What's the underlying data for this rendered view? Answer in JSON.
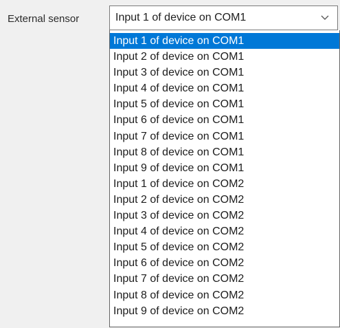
{
  "field": {
    "label": "External sensor",
    "selected_value": "Input 1 of device on COM1",
    "dropdown_icon": "chevron-down-icon"
  },
  "colors": {
    "highlight": "#0078d7",
    "highlight_text": "#ffffff",
    "text": "#1c1c1c"
  },
  "options": [
    {
      "label": "Input 1 of device on COM1",
      "selected": true
    },
    {
      "label": "Input 2 of device on COM1",
      "selected": false
    },
    {
      "label": "Input 3 of device on COM1",
      "selected": false
    },
    {
      "label": "Input 4 of device on COM1",
      "selected": false
    },
    {
      "label": "Input 5 of device on COM1",
      "selected": false
    },
    {
      "label": "Input 6 of device on COM1",
      "selected": false
    },
    {
      "label": "Input 7 of device on COM1",
      "selected": false
    },
    {
      "label": "Input 8 of device on COM1",
      "selected": false
    },
    {
      "label": "Input 9 of device on COM1",
      "selected": false
    },
    {
      "label": "Input 1 of device on COM2",
      "selected": false
    },
    {
      "label": "Input 2 of device on COM2",
      "selected": false
    },
    {
      "label": "Input 3 of device on COM2",
      "selected": false
    },
    {
      "label": "Input 4 of device on COM2",
      "selected": false
    },
    {
      "label": "Input 5 of device on COM2",
      "selected": false
    },
    {
      "label": "Input 6 of device on COM2",
      "selected": false
    },
    {
      "label": "Input 7 of device on COM2",
      "selected": false
    },
    {
      "label": "Input 8 of device on COM2",
      "selected": false
    },
    {
      "label": "Input 9 of device on COM2",
      "selected": false
    }
  ]
}
